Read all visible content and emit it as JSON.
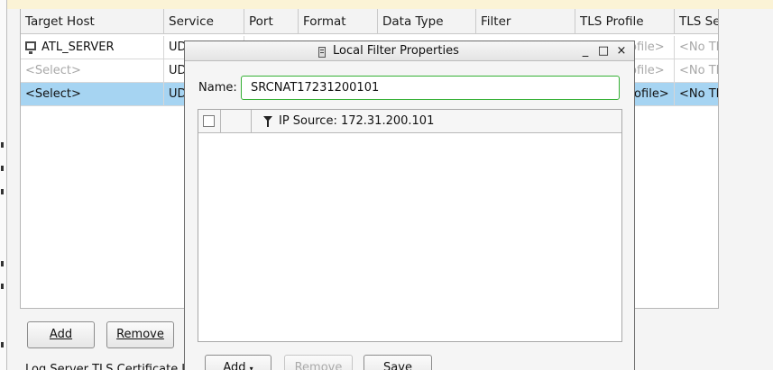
{
  "table": {
    "columns": [
      "Target Host",
      "Service",
      "Port",
      "Format",
      "Data Type",
      "Filter",
      "TLS Profile",
      "TLS Ser"
    ],
    "rows": [
      {
        "host": "ATL_SERVER",
        "service": "UD",
        "tls_profile": "ofile>",
        "tls_server": "<No TLS"
      },
      {
        "host": "<Select>",
        "service": "UD",
        "tls_profile": "ofile>",
        "tls_server": "<No TLS"
      },
      {
        "host": "<Select>",
        "service": "UD",
        "tls_profile": "rofile>",
        "tls_server": "<No TLS"
      }
    ]
  },
  "buttons": {
    "add_label": "Add",
    "remove_label": "Remove"
  },
  "bottom_label": "Log Server TLS Certificate Use",
  "dialog": {
    "title": "Local Filter Properties",
    "minimize": "_",
    "maximize": "□",
    "close": "×",
    "name_label": "Name:",
    "name_value": "SRCNAT17231200101",
    "filter_text": "IP Source: 172.31.200.101",
    "add_label": "Add",
    "remove_label": "Remove",
    "save_label": "Save"
  }
}
